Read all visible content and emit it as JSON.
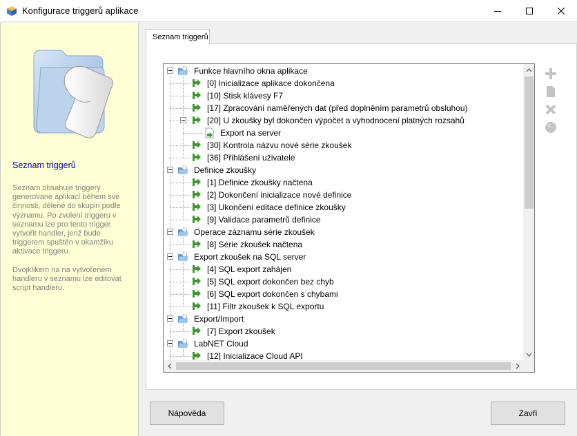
{
  "window": {
    "title": "Konfigurace triggerů aplikace"
  },
  "sidebar": {
    "heading": "Seznam triggerů",
    "description": "Seznam obsahuje triggery generované aplikací během své činnosti, dělené do skupin podle významu. Po zvolení triggeru v seznamu lze pro tento trigger vytvořit handler, jenž bude triggerem spuštěn v okamžiku aktivace triggeru.\n\nDvojklikem na na vytvořeném handleru v seznamu lze editovat script handleru."
  },
  "tabs": [
    {
      "label": "Seznam triggerů"
    }
  ],
  "tree": {
    "rows": [
      {
        "level": 0,
        "label": "Funkce hlavního okna aplikace",
        "type": "group"
      },
      {
        "level": 1,
        "label": "[0] Inicializace aplikace dokončena",
        "type": "trigger"
      },
      {
        "level": 1,
        "label": "[10] Stisk klávesy F7",
        "type": "trigger"
      },
      {
        "level": 1,
        "label": "[17] Zpracování naměřených dat (před doplněním parametrů obsluhou)",
        "type": "trigger"
      },
      {
        "level": 1,
        "label": "[20] U zkoušky byl dokončen výpočet a vyhodnocení platných rozsahů",
        "type": "trigger",
        "expanded": true
      },
      {
        "level": 2,
        "label": "Export na server",
        "type": "handler"
      },
      {
        "level": 1,
        "label": "[30] Kontrola názvu nové série zkoušek",
        "type": "trigger"
      },
      {
        "level": 1,
        "label": "[36] Přihlášení uživatele",
        "type": "trigger"
      },
      {
        "level": 0,
        "label": "Definice zkoušky",
        "type": "group"
      },
      {
        "level": 1,
        "label": "[1] Definice zkoušky načtena",
        "type": "trigger"
      },
      {
        "level": 1,
        "label": "[2] Dokončení inicializace nové definice",
        "type": "trigger"
      },
      {
        "level": 1,
        "label": "[3] Ukončení editace definice zkoušky",
        "type": "trigger"
      },
      {
        "level": 1,
        "label": "[9] Validace parametrů definice",
        "type": "trigger"
      },
      {
        "level": 0,
        "label": "Operace záznamu série zkoušek",
        "type": "group"
      },
      {
        "level": 1,
        "label": "[8] Série zkoušek načtena",
        "type": "trigger"
      },
      {
        "level": 0,
        "label": "Export zkoušek na SQL server",
        "type": "group"
      },
      {
        "level": 1,
        "label": "[4] SQL export zahájen",
        "type": "trigger"
      },
      {
        "level": 1,
        "label": "[5] SQL export dokončen bez chyb",
        "type": "trigger"
      },
      {
        "level": 1,
        "label": "[6] SQL export dokončen s chybami",
        "type": "trigger"
      },
      {
        "level": 1,
        "label": "[11] Filtr zkoušek k SQL exportu",
        "type": "trigger"
      },
      {
        "level": 0,
        "label": "Export/Import",
        "type": "group"
      },
      {
        "level": 1,
        "label": "[7] Export zkoušek",
        "type": "trigger"
      },
      {
        "level": 0,
        "label": "LabNET Cloud",
        "type": "group"
      },
      {
        "level": 1,
        "label": "[12] Inicializace Cloud API",
        "type": "trigger"
      }
    ]
  },
  "toolbar": {
    "buttons": [
      {
        "name": "add-handler-button",
        "icon": "plus-icon"
      },
      {
        "name": "edit-handler-button",
        "icon": "document-icon"
      },
      {
        "name": "delete-handler-button",
        "icon": "delete-x-icon"
      },
      {
        "name": "disable-handler-button",
        "icon": "circle-icon"
      }
    ]
  },
  "buttons": {
    "help": "Nápověda",
    "close": "Zavři"
  },
  "colors": {
    "sidebar_bg": "#ffffd5",
    "sidebar_heading": "#0000c0",
    "trigger_arrow": "#3a9a2a",
    "folder": "#5c9ed8"
  }
}
